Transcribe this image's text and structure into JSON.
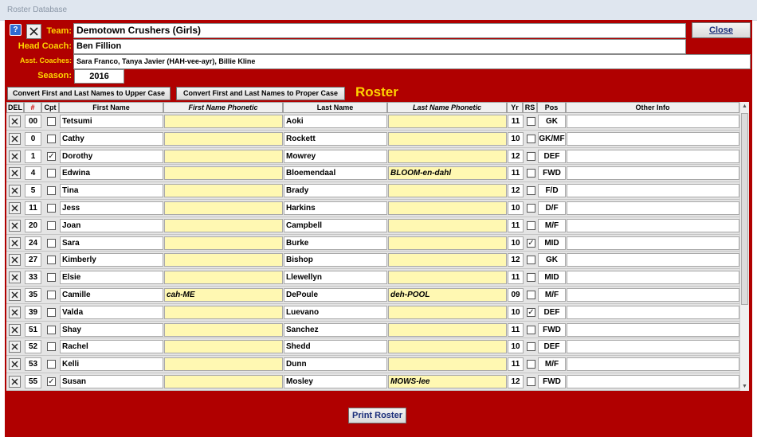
{
  "window": {
    "title": "Roster Database"
  },
  "header": {
    "help_glyph": "?",
    "team_label": "Team:",
    "team_value": "Demotown Crushers (Girls)",
    "head_coach_label": "Head Coach:",
    "head_coach_value": "Ben Fillion",
    "asst_label": "Asst. Coaches:",
    "asst_value": "Sara Franco, Tanya Javier (HAH-vee-ayr), Billie Kline",
    "season_label": "Season:",
    "season_value": "2016",
    "close_label": "Close"
  },
  "toolbar": {
    "upper_case_label": "Convert First and Last Names to Upper Case",
    "proper_case_label": "Convert First and Last Names to Proper Case",
    "roster_title": "Roster"
  },
  "columns": {
    "del": "DEL",
    "num": "#",
    "cpt": "Cpt",
    "first": "First Name",
    "first_phonetic": "First Name Phonetic",
    "last": "Last Name",
    "last_phonetic": "Last Name Phonetic",
    "yr": "Yr",
    "rs": "RS",
    "pos": "Pos",
    "other": "Other Info"
  },
  "rows": [
    {
      "num": "00",
      "cpt": false,
      "first": "Tetsumi",
      "first_phonetic": "",
      "last": "Aoki",
      "last_phonetic": "",
      "yr": "11",
      "rs": false,
      "pos": "GK",
      "other": ""
    },
    {
      "num": "0",
      "cpt": false,
      "first": "Cathy",
      "first_phonetic": "",
      "last": "Rockett",
      "last_phonetic": "",
      "yr": "10",
      "rs": false,
      "pos": "GK/MF",
      "other": ""
    },
    {
      "num": "1",
      "cpt": true,
      "first": "Dorothy",
      "first_phonetic": "",
      "last": "Mowrey",
      "last_phonetic": "",
      "yr": "12",
      "rs": false,
      "pos": "DEF",
      "other": ""
    },
    {
      "num": "4",
      "cpt": false,
      "first": "Edwina",
      "first_phonetic": "",
      "last": "Bloemendaal",
      "last_phonetic": "BLOOM-en-dahl",
      "yr": "11",
      "rs": false,
      "pos": "FWD",
      "other": ""
    },
    {
      "num": "5",
      "cpt": false,
      "first": "Tina",
      "first_phonetic": "",
      "last": "Brady",
      "last_phonetic": "",
      "yr": "12",
      "rs": false,
      "pos": "F/D",
      "other": ""
    },
    {
      "num": "11",
      "cpt": false,
      "first": "Jess",
      "first_phonetic": "",
      "last": "Harkins",
      "last_phonetic": "",
      "yr": "10",
      "rs": false,
      "pos": "D/F",
      "other": ""
    },
    {
      "num": "20",
      "cpt": false,
      "first": "Joan",
      "first_phonetic": "",
      "last": "Campbell",
      "last_phonetic": "",
      "yr": "11",
      "rs": false,
      "pos": "M/F",
      "other": ""
    },
    {
      "num": "24",
      "cpt": false,
      "first": "Sara",
      "first_phonetic": "",
      "last": "Burke",
      "last_phonetic": "",
      "yr": "10",
      "rs": true,
      "pos": "MID",
      "other": ""
    },
    {
      "num": "27",
      "cpt": false,
      "first": "Kimberly",
      "first_phonetic": "",
      "last": "Bishop",
      "last_phonetic": "",
      "yr": "12",
      "rs": false,
      "pos": "GK",
      "other": ""
    },
    {
      "num": "33",
      "cpt": false,
      "first": "Elsie",
      "first_phonetic": "",
      "last": "Llewellyn",
      "last_phonetic": "",
      "yr": "11",
      "rs": false,
      "pos": "MID",
      "other": ""
    },
    {
      "num": "35",
      "cpt": false,
      "first": "Camille",
      "first_phonetic": "cah-ME",
      "last": "DePoule",
      "last_phonetic": "deh-POOL",
      "yr": "09",
      "rs": false,
      "pos": "M/F",
      "other": ""
    },
    {
      "num": "39",
      "cpt": false,
      "first": "Valda",
      "first_phonetic": "",
      "last": "Luevano",
      "last_phonetic": "",
      "yr": "10",
      "rs": true,
      "pos": "DEF",
      "other": ""
    },
    {
      "num": "51",
      "cpt": false,
      "first": "Shay",
      "first_phonetic": "",
      "last": "Sanchez",
      "last_phonetic": "",
      "yr": "11",
      "rs": false,
      "pos": "FWD",
      "other": ""
    },
    {
      "num": "52",
      "cpt": false,
      "first": "Rachel",
      "first_phonetic": "",
      "last": "Shedd",
      "last_phonetic": "",
      "yr": "10",
      "rs": false,
      "pos": "DEF",
      "other": ""
    },
    {
      "num": "53",
      "cpt": false,
      "first": "Kelli",
      "first_phonetic": "",
      "last": "Dunn",
      "last_phonetic": "",
      "yr": "11",
      "rs": false,
      "pos": "M/F",
      "other": ""
    },
    {
      "num": "55",
      "cpt": true,
      "first": "Susan",
      "first_phonetic": "",
      "last": "Mosley",
      "last_phonetic": "MOWS-lee",
      "yr": "12",
      "rs": false,
      "pos": "FWD",
      "other": ""
    }
  ],
  "footer": {
    "print_label": "Print Roster"
  },
  "colors": {
    "form_bg": "#b00000",
    "label": "#ffd400",
    "phonetic_bg": "#fff8b2"
  }
}
